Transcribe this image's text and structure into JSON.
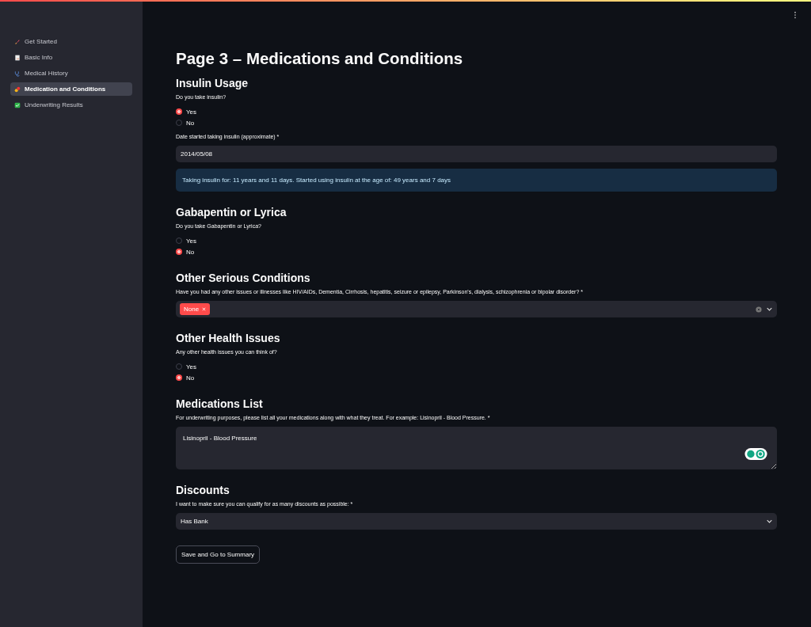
{
  "sidebar": {
    "items": [
      {
        "label": "Get Started",
        "selected": false
      },
      {
        "label": "Basic Info",
        "selected": false
      },
      {
        "label": "Medical History",
        "selected": false
      },
      {
        "label": "Medication and Conditions",
        "selected": true
      },
      {
        "label": "Underwriting Results",
        "selected": false
      }
    ]
  },
  "title": "Page 3 – Medications and Conditions",
  "sections": [
    {
      "heading": "Insulin Usage",
      "fields": [
        {
          "kind": "radio",
          "label": "Do you take insulin?",
          "options": [
            {
              "label": "Yes",
              "selected": true
            },
            {
              "label": "No",
              "selected": false
            }
          ]
        },
        {
          "kind": "date",
          "label": "Date started taking insulin (approximate) *",
          "value": "2014/05/08"
        },
        {
          "kind": "info",
          "text": "Taking insulin for: 11 years and 11 days. Started using insulin at the age of: 49 years and 7 days"
        }
      ]
    },
    {
      "heading": "Gabapentin or Lyrica",
      "fields": [
        {
          "kind": "radio",
          "label": "Do you take Gabapentin or Lyrica?",
          "options": [
            {
              "label": "Yes",
              "selected": false
            },
            {
              "label": "No",
              "selected": true
            }
          ]
        }
      ]
    },
    {
      "heading": "Other Serious Conditions",
      "fields": [
        {
          "kind": "multiselect",
          "label": "Have you had any other issues or illnesses like HIV/AIDs, Dementia, Cirrhosis, hepatitis, seizure or epilepsy, Parkinson's, dialysis, schizophrenia or bipolar disorder? *",
          "tags": [
            "None"
          ]
        }
      ]
    },
    {
      "heading": "Other Health Issues",
      "fields": [
        {
          "kind": "radio",
          "label": "Any other health issues you can think of?",
          "options": [
            {
              "label": "Yes",
              "selected": false
            },
            {
              "label": "No",
              "selected": true
            }
          ]
        }
      ]
    },
    {
      "heading": "Medications List",
      "fields": [
        {
          "kind": "textarea",
          "label": "For underwriting purposes, please list all your medications along with what they treat. For example: Lisinopril - Blood Pressure. *",
          "value": "Lisinopril - Blood Pressure"
        }
      ]
    },
    {
      "heading": "Discounts",
      "fields": [
        {
          "kind": "select",
          "label": "I want to make sure you can qualify for as many discounts as possible: *",
          "value": "Has Bank"
        }
      ]
    }
  ],
  "button": "Save and Go to Summary"
}
